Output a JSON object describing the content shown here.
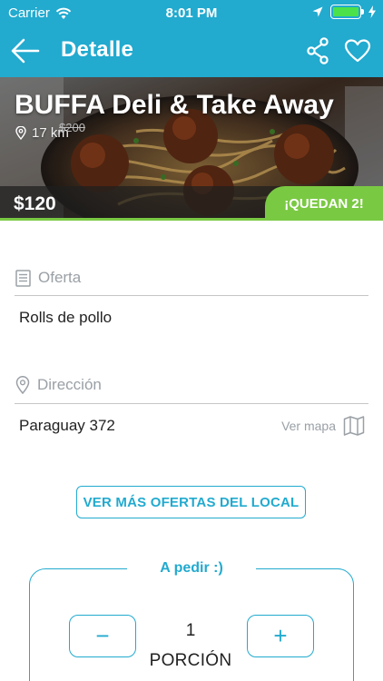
{
  "status_bar": {
    "carrier": "Carrier",
    "time": "8:01 PM"
  },
  "nav": {
    "title": "Detalle",
    "back_icon": "arrow-left-icon",
    "share_icon": "share-icon",
    "favorite_icon": "heart-icon"
  },
  "hero": {
    "title": "BUFFA Deli & Take Away",
    "distance": "17 km",
    "price": "$120",
    "old_price": "$200",
    "badge": "¡QUEDAN 2!"
  },
  "offer": {
    "label": "Oferta",
    "value": "Rolls de pollo"
  },
  "address": {
    "label": "Dirección",
    "value": "Paraguay 372",
    "map_link": "Ver mapa"
  },
  "more_offers_button": "VER MÁS OFERTAS DEL LOCAL",
  "order": {
    "title": "A pedir :)",
    "minus": "−",
    "plus": "+",
    "quantity": "1",
    "unit": "PORCIÓN"
  },
  "colors": {
    "primary": "#22aacf",
    "accent_green": "#7ac943",
    "text": "#222222",
    "muted": "#9aa0a6"
  }
}
